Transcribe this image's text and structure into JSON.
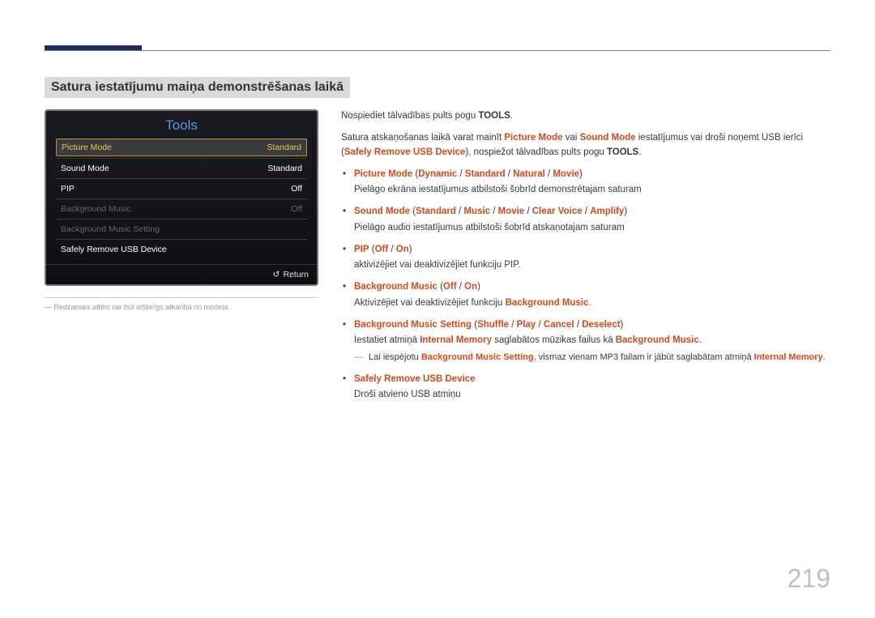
{
  "page_number": "219",
  "heading": "Satura iestatījumu maiņa demonstrēšanas laikā",
  "panel": {
    "title": "Tools",
    "rows": [
      {
        "label": "Picture Mode",
        "value": "Standard",
        "selected": true
      },
      {
        "label": "Sound Mode",
        "value": "Standard"
      },
      {
        "label": "PIP",
        "value": "Off"
      },
      {
        "label": "Background Music",
        "value": "Off",
        "dim": true
      },
      {
        "label": "Background Music Setting",
        "value": "",
        "dim": true
      },
      {
        "label": "Safely Remove USB Device",
        "value": ""
      }
    ],
    "return": "Return"
  },
  "left_note": "Redzamais attēls var būt atšķirīgs atkarībā no modeļa.",
  "intro1_a": "Nospiediet tālvadības pults pogu ",
  "intro1_b": "TOOLS",
  "intro1_c": ".",
  "intro2": {
    "a": "Satura atskaņošanas laikā varat mainīt ",
    "pm": "Picture Mode",
    "vai1": " vai ",
    "sm": "Sound Mode",
    "b": " iestatījumus vai droši noņemt USB ierīci (",
    "srud": "Safely Remove USB Device",
    "c": "), nospiežot tālvadības pults pogu ",
    "tools": "TOOLS",
    "d": "."
  },
  "bullets": [
    {
      "title_parts": [
        "Picture Mode",
        " (",
        "Dynamic",
        " / ",
        "Standard",
        " / ",
        "Natural",
        " / ",
        "Movie",
        ")"
      ],
      "desc": "Pielāgo ekrāna iestatījumus atbilstoši šobrīd demonstrētajam saturam"
    },
    {
      "title_parts": [
        "Sound Mode",
        " (",
        "Standard",
        " / ",
        "Music",
        " / ",
        "Movie",
        " / ",
        "Clear Voice",
        " / ",
        "Amplify",
        ")"
      ],
      "desc": "Pielāgo audio iestatījumus atbilstoši šobrīd atskaņotajam saturam"
    },
    {
      "title_parts": [
        "PIP",
        " (",
        "Off",
        " / ",
        "On",
        ")"
      ],
      "desc": "aktivizējiet vai deaktivizējiet funkciju PIP."
    },
    {
      "title_parts": [
        "Background Music",
        " (",
        "Off",
        " / ",
        "On",
        ")"
      ],
      "desc_pre": "Aktivizējiet vai deaktivizējiet funkciju ",
      "desc_hl": "Background Music",
      "desc_post": "."
    },
    {
      "title_parts": [
        "Background Music Setting",
        " (",
        "Shuffle",
        " / ",
        "Play",
        " / ",
        "Cancel",
        " / ",
        "Deselect",
        ")"
      ],
      "desc_pre": "Iestatiet atmiņā ",
      "desc_hl1": "Internal Memory",
      "desc_mid": " saglabātos mūzikas failus kā ",
      "desc_hl2": "Background Music",
      "desc_post": ".",
      "sub": {
        "a": "Lai iespējotu ",
        "h1": "Background Music Setting",
        "b": ", vismaz vienam MP3 failam ir jābūt saglabātam atmiņā ",
        "h2": "Internal Memory",
        "c": "."
      }
    },
    {
      "title_parts": [
        "Safely Remove USB Device"
      ],
      "desc": "Droši atvieno USB atmiņu"
    }
  ]
}
